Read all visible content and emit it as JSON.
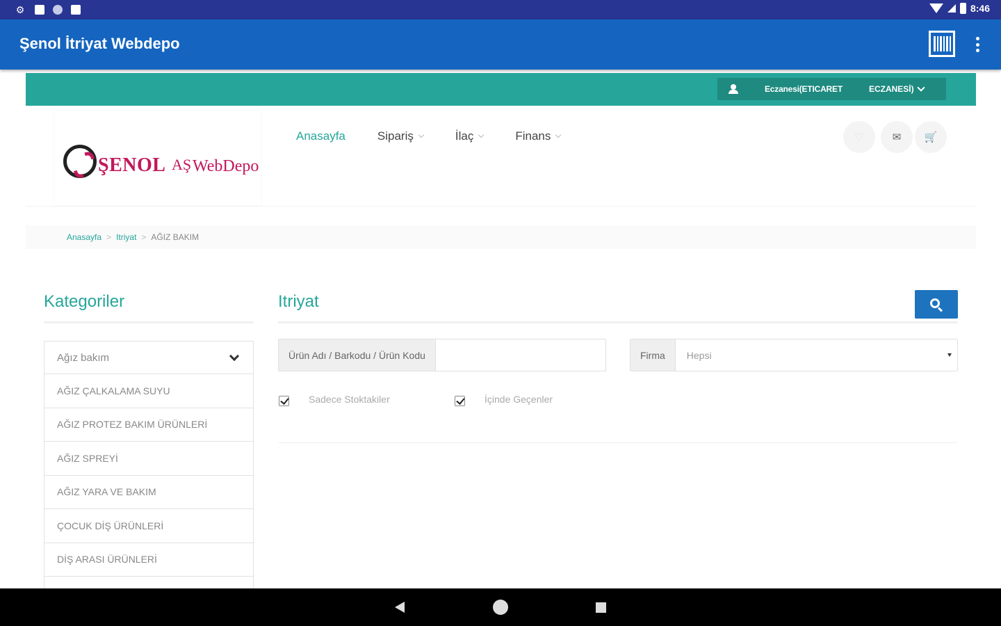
{
  "status_bar": {
    "time": "8:46"
  },
  "app_bar": {
    "title": "Şenol İtriyat Webdepo",
    "barcode_icon": "barcode-scan-icon",
    "more_icon": "more-vert-icon"
  },
  "user_bar": {
    "user_label": "Eczanesi(ETICARET",
    "user_label_2": "ECZANESİ)",
    "color": "#26a69a"
  },
  "logo": {
    "brand": "ŞENOL",
    "suffix_small": "AŞ",
    "suffix": "WebDepo"
  },
  "nav": {
    "items": [
      {
        "label": "Anasayfa",
        "active": true
      },
      {
        "label": "Sipariş",
        "active": false
      },
      {
        "label": "İlaç",
        "active": false
      },
      {
        "label": "Finans",
        "active": false
      }
    ]
  },
  "header_actions": {
    "heart_icon": "heart-icon",
    "mail_icon": "mail-icon",
    "cart_icon": "cart-icon"
  },
  "breadcrumb": {
    "items": [
      "Anasayfa",
      "Itriyat",
      "AĞIZ BAKIM"
    ]
  },
  "sidebar": {
    "title": "Kategoriler",
    "selected": "Ağız bakım",
    "items": [
      "AĞIZ ÇALKALAMA SUYU",
      "AĞIZ PROTEZ BAKIM ÜRÜNLERİ",
      "AĞIZ SPREYİ",
      "AĞIZ YARA VE BAKIM",
      "ÇOCUK DİŞ ÜRÜNLERİ",
      "DİŞ ARASI ÜRÜNLERİ"
    ]
  },
  "main": {
    "title": "Itriyat",
    "search_icon": "search-icon",
    "product_field_label": "Ürün Adı / Barkodu / Ürün Kodu",
    "product_field_value": "",
    "firm_label": "Firma",
    "firm_value": "Hepsi",
    "check_stock_label": "Sadece Stoktakiler",
    "check_contains_label": "İçinde Geçenler",
    "check_stock_checked": true,
    "check_contains_checked": true,
    "accent_button_color": "#1e73be"
  }
}
